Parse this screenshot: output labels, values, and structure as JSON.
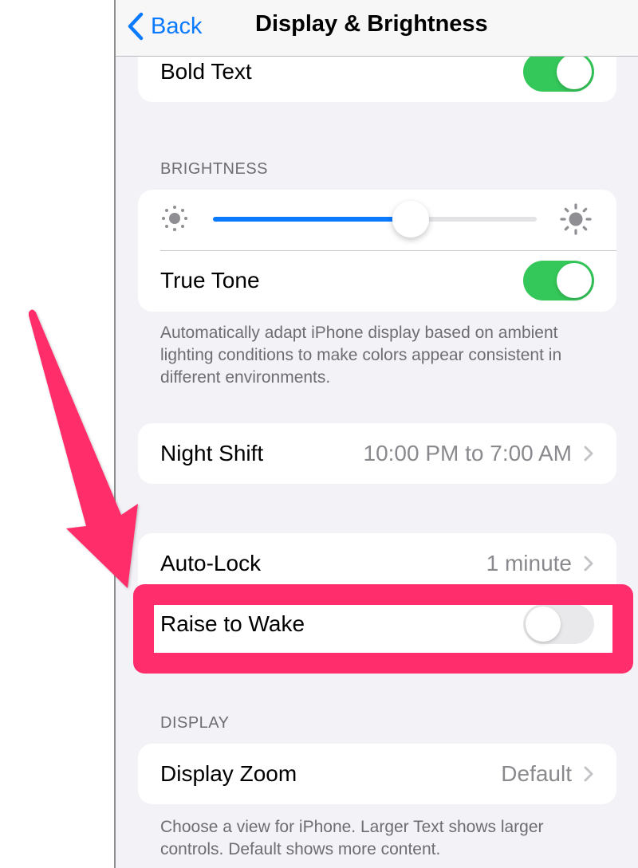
{
  "navbar": {
    "back_label": "Back",
    "title": "Display & Brightness"
  },
  "bold_text": {
    "label": "Bold Text",
    "enabled": true
  },
  "brightness": {
    "header": "BRIGHTNESS",
    "slider_level": 0.61,
    "true_tone_label": "True Tone",
    "true_tone_enabled": true,
    "footer": "Automatically adapt iPhone display based on ambient lighting conditions to make colors appear consistent in different environments."
  },
  "night_shift": {
    "label": "Night Shift",
    "value": "10:00 PM to 7:00 AM"
  },
  "lock": {
    "auto_lock_label": "Auto-Lock",
    "auto_lock_value": "1 minute",
    "raise_to_wake_label": "Raise to Wake",
    "raise_to_wake_enabled": false
  },
  "display": {
    "header": "DISPLAY",
    "zoom_label": "Display Zoom",
    "zoom_value": "Default",
    "footer": "Choose a view for iPhone. Larger Text shows larger controls. Default shows more content."
  },
  "colors": {
    "accent_blue": "#0a7aff",
    "switch_on_green": "#34c759",
    "annotation_pink": "#ff2d6b",
    "background": "#f2f2f7"
  },
  "annotation": {
    "highlight_target": "Raise to Wake",
    "arrow_icon": "pointer-arrow-icon"
  }
}
